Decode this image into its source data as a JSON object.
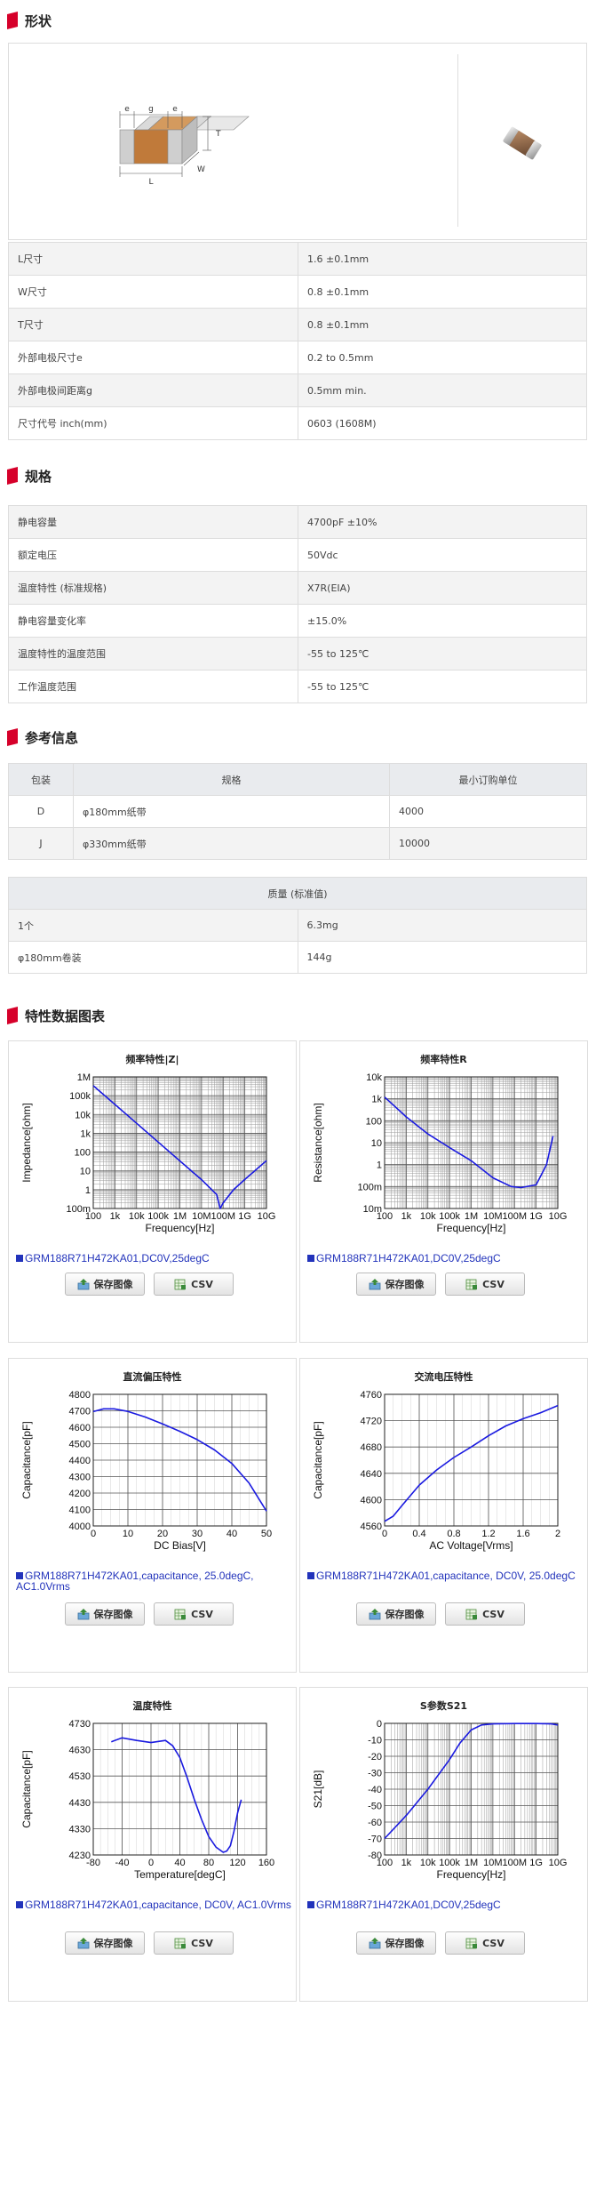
{
  "colors": {
    "accent": "#d6002a",
    "curve": "#1a1ae0",
    "legend": "#2233bb"
  },
  "sections": {
    "shape": {
      "title": "形状",
      "icon": "red-flag-icon"
    },
    "spec": {
      "title": "规格",
      "icon": "red-flag-icon"
    },
    "ref": {
      "title": "参考信息",
      "icon": "red-flag-icon"
    },
    "charts": {
      "title": "特性数据图表",
      "icon": "red-flag-icon"
    }
  },
  "diagram": {
    "e1": "e",
    "g": "g",
    "e2": "e",
    "T": "T",
    "L": "L",
    "W": "W"
  },
  "dimensions": [
    {
      "label": "L尺寸",
      "value": "1.6 ±0.1mm"
    },
    {
      "label": "W尺寸",
      "value": "0.8 ±0.1mm"
    },
    {
      "label": "T尺寸",
      "value": "0.8 ±0.1mm"
    },
    {
      "label": "外部电极尺寸e",
      "value": "0.2 to 0.5mm"
    },
    {
      "label": "外部电极间距离g",
      "value": "0.5mm min."
    },
    {
      "label": "尺寸代号 inch(mm)",
      "value": "0603 (1608M)"
    }
  ],
  "specs": [
    {
      "label": "静电容量",
      "value": "4700pF ±10%"
    },
    {
      "label": "额定电压",
      "value": "50Vdc"
    },
    {
      "label": "温度特性 (标准规格)",
      "value": "X7R(EIA)"
    },
    {
      "label": "静电容量变化率",
      "value": "±15.0%"
    },
    {
      "label": "温度特性的温度范围",
      "value": "-55 to 125℃"
    },
    {
      "label": "工作温度范围",
      "value": "-55 to 125℃"
    }
  ],
  "packaging": {
    "headers": {
      "code": "包装",
      "spec": "规格",
      "moq": "最小订购单位"
    },
    "rows": [
      {
        "code": "D",
        "spec": "φ180mm纸带",
        "moq": "4000"
      },
      {
        "code": "J",
        "spec": "φ330mm纸带",
        "moq": "10000"
      }
    ]
  },
  "mass": {
    "header": "质量 (标准值)",
    "rows": [
      {
        "label": "1个",
        "value": "6.3mg"
      },
      {
        "label": "φ180mm卷装",
        "value": "144g"
      }
    ]
  },
  "buttons": {
    "save": "保存图像",
    "csv": "CSV"
  },
  "chart_data": [
    {
      "type": "line",
      "title": "频率特性|Z|",
      "xlabel": "Frequency[Hz]",
      "ylabel": "Impedance[ohm]",
      "xscale": "log",
      "yscale": "log",
      "xlim": [
        100,
        10000000000
      ],
      "ylim": [
        1e-08,
        1000000
      ],
      "xticks": [
        "100",
        "1k",
        "10k",
        "100k",
        "1M",
        "10M",
        "100M",
        "1G",
        "10G"
      ],
      "yticks": [
        "1M",
        "100k",
        "10k",
        "1k",
        "100",
        "10",
        "1",
        "100m"
      ],
      "legend": "GRM188R71H472KA01,DC0V,25degC",
      "series": [
        {
          "x": [
            100,
            1000,
            10000,
            100000,
            1000000,
            10000000,
            50000000,
            73000000,
            100000000,
            300000000,
            1000000000,
            10000000000
          ],
          "y": [
            340000,
            34000,
            3400,
            340,
            34,
            3.4,
            0.55,
            0.1,
            0.2,
            1.0,
            3.5,
            35
          ]
        }
      ]
    },
    {
      "type": "line",
      "title": "频率特性R",
      "xlabel": "Frequency[Hz]",
      "ylabel": "Resistance[ohm]",
      "xscale": "log",
      "yscale": "log",
      "xlim": [
        100,
        10000000000
      ],
      "ylim": [
        0.01,
        10000
      ],
      "xticks": [
        "100",
        "1k",
        "10k",
        "100k",
        "1M",
        "10M",
        "100M",
        "1G",
        "10G"
      ],
      "yticks": [
        "10k",
        "1k",
        "100",
        "10",
        "1",
        "100m",
        "10m"
      ],
      "legend": "GRM188R71H472KA01,DC0V,25degC",
      "series": [
        {
          "x": [
            100,
            1000,
            10000,
            100000,
            1000000,
            10000000,
            70000000,
            200000000,
            1000000000,
            3000000000,
            6000000000
          ],
          "y": [
            1200,
            150,
            25,
            6,
            1.5,
            0.25,
            0.1,
            0.09,
            0.12,
            1.0,
            20
          ]
        }
      ]
    },
    {
      "type": "line",
      "title": "直流偏压特性",
      "xlabel": "DC Bias[V]",
      "ylabel": "Capacitance[pF]",
      "xlim": [
        0,
        50
      ],
      "ylim": [
        4000,
        4800
      ],
      "xticks": [
        "0",
        "10",
        "20",
        "30",
        "40",
        "50"
      ],
      "yticks": [
        "4800",
        "4700",
        "4600",
        "4500",
        "4400",
        "4300",
        "4200",
        "4100",
        "4000"
      ],
      "legend": "GRM188R71H472KA01,capacitance, 25.0degC, AC1.0Vrms",
      "series": [
        {
          "x": [
            0,
            3,
            6,
            10,
            15,
            20,
            25,
            30,
            35,
            40,
            45,
            50
          ],
          "y": [
            4695,
            4712,
            4712,
            4696,
            4662,
            4620,
            4575,
            4525,
            4462,
            4380,
            4260,
            4090
          ]
        }
      ]
    },
    {
      "type": "line",
      "title": "交流电压特性",
      "xlabel": "AC Voltage[Vrms]",
      "ylabel": "Capacitance[pF]",
      "xlim": [
        0,
        2
      ],
      "ylim": [
        4560,
        4760
      ],
      "xticks": [
        "0",
        "0.4",
        "0.8",
        "1.2",
        "1.6",
        "2"
      ],
      "yticks": [
        "4760",
        "4720",
        "4680",
        "4640",
        "4600",
        "4560"
      ],
      "legend": "GRM188R71H472KA01,capacitance, DC0V, 25.0degC",
      "series": [
        {
          "x": [
            0,
            0.1,
            0.2,
            0.4,
            0.6,
            0.8,
            1.0,
            1.2,
            1.4,
            1.6,
            1.8,
            2.0
          ],
          "y": [
            4567,
            4575,
            4591,
            4622,
            4645,
            4664,
            4680,
            4697,
            4712,
            4723,
            4732,
            4743
          ]
        }
      ]
    },
    {
      "type": "line",
      "title": "温度特性",
      "xlabel": "Temperature[degC]",
      "ylabel": "Capacitance[pF]",
      "xlim": [
        -80,
        160
      ],
      "ylim": [
        4230,
        4730
      ],
      "xticks": [
        "-80",
        "-40",
        "0",
        "40",
        "80",
        "120",
        "160"
      ],
      "yticks": [
        "4730",
        "4630",
        "4530",
        "4430",
        "4330",
        "4230"
      ],
      "legend": "GRM188R71H472KA01,capacitance, DC0V, AC1.0Vrms",
      "series": [
        {
          "x": [
            -55,
            -40,
            -20,
            0,
            20,
            30,
            40,
            50,
            60,
            70,
            80,
            90,
            100,
            105,
            110,
            115,
            120,
            125
          ],
          "y": [
            4660,
            4675,
            4665,
            4657,
            4665,
            4645,
            4600,
            4525,
            4440,
            4365,
            4300,
            4260,
            4240,
            4245,
            4265,
            4320,
            4390,
            4440
          ]
        }
      ]
    },
    {
      "type": "line",
      "title": "S参数S21",
      "xlabel": "Frequency[Hz]",
      "ylabel": "S21[dB]",
      "xscale": "log",
      "xlim": [
        100,
        10000000000
      ],
      "ylim": [
        -80,
        0
      ],
      "xticks": [
        "100",
        "1k",
        "10k",
        "100k",
        "1M",
        "10M",
        "100M",
        "1G",
        "10G"
      ],
      "yticks": [
        "0",
        "-10",
        "-20",
        "-30",
        "-40",
        "-50",
        "-60",
        "-70",
        "-80"
      ],
      "legend": "GRM188R71H472KA01,DC0V,25degC",
      "series": [
        {
          "x": [
            100,
            1000,
            10000,
            100000,
            300000,
            1000000,
            3000000,
            10000000,
            100000000,
            1000000000,
            5000000000,
            10000000000
          ],
          "y": [
            -70,
            -56,
            -40,
            -22,
            -12,
            -4,
            -1,
            -0.3,
            -0.1,
            -0.1,
            -0.3,
            -1
          ]
        }
      ]
    }
  ]
}
